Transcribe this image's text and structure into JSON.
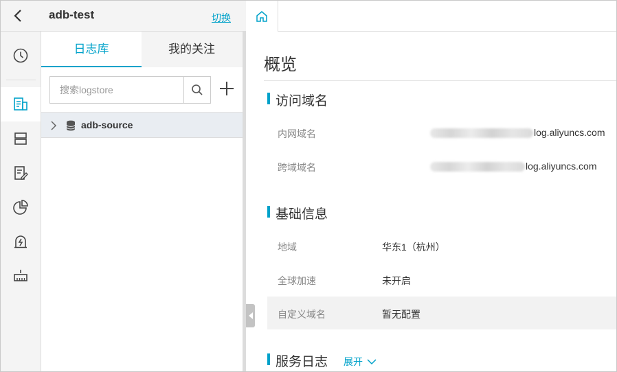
{
  "header": {
    "project_name": "adb-test",
    "switch_label": "切换"
  },
  "rail": {
    "items": [
      {
        "icon": "clock-icon"
      },
      {
        "icon": "logstore-icon",
        "active": true
      },
      {
        "icon": "server-icon"
      },
      {
        "icon": "edit-doc-icon"
      },
      {
        "icon": "pie-chart-icon"
      },
      {
        "icon": "alarm-icon"
      },
      {
        "icon": "shipper-icon"
      }
    ]
  },
  "panel": {
    "tabs": [
      {
        "label": "日志库",
        "active": true
      },
      {
        "label": "我的关注"
      }
    ],
    "search": {
      "placeholder": "搜索logstore",
      "value": ""
    },
    "logstores": [
      {
        "name": "adb-source"
      }
    ]
  },
  "main": {
    "title": "概览",
    "sections": {
      "domain": {
        "title": "访问域名",
        "rows": [
          {
            "label": "内网域名",
            "value": "log.aliyuncs.com"
          },
          {
            "label": "跨域域名",
            "value": "log.aliyuncs.com"
          }
        ]
      },
      "basic": {
        "title": "基础信息",
        "rows": [
          {
            "label": "地域",
            "value": "华东1（杭州）"
          },
          {
            "label": "全球加速",
            "value": "未开启"
          },
          {
            "label": "自定义域名",
            "value": "暂无配置"
          }
        ]
      },
      "service_log": {
        "title": "服务日志",
        "expand_label": "展开"
      }
    }
  },
  "colors": {
    "accent": "#00a2ca",
    "rail_bg": "#f4f4f4",
    "row_highlight": "#e9edf2"
  }
}
